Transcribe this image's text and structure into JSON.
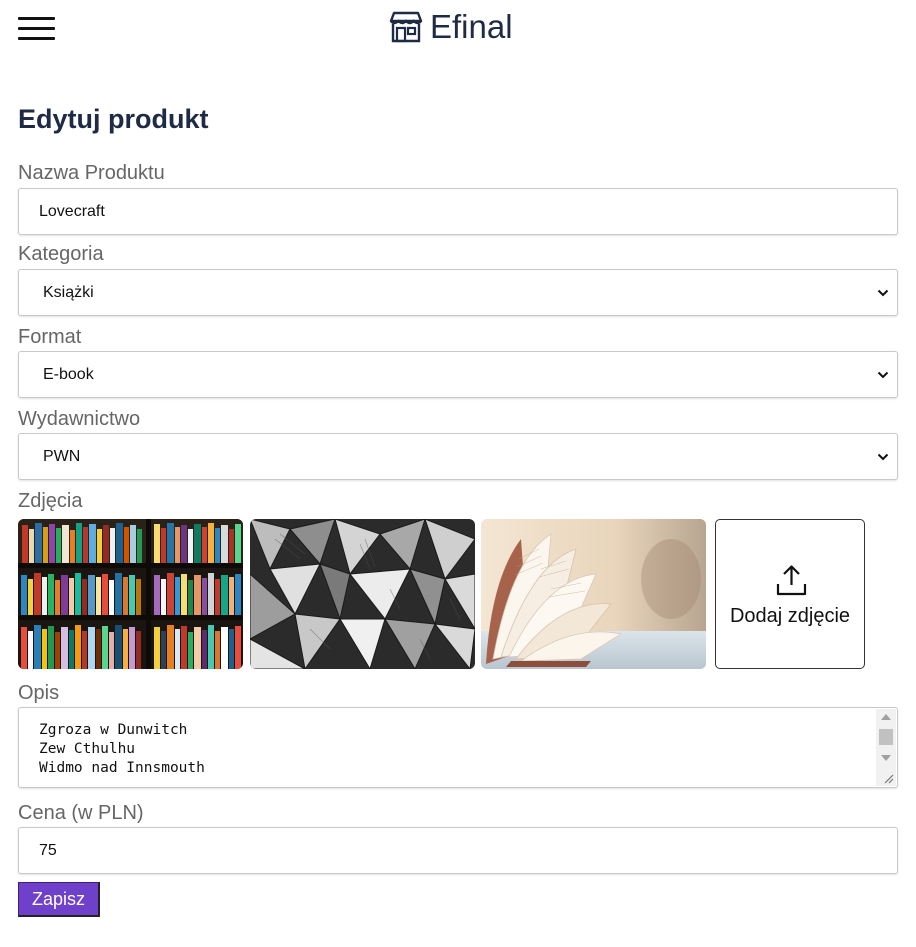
{
  "header": {
    "brand_name": "Efinal",
    "menu_icon": "hamburger-menu-icon",
    "logo_icon": "store-icon"
  },
  "page": {
    "title": "Edytuj produkt"
  },
  "form": {
    "name": {
      "label": "Nazwa Produktu",
      "value": "Lovecraft"
    },
    "category": {
      "label": "Kategoria",
      "value": "Książki"
    },
    "format": {
      "label": "Format",
      "value": "E-book"
    },
    "publisher": {
      "label": "Wydawnictwo",
      "value": "PWN"
    },
    "photos": {
      "label": "Zdjęcia",
      "items": [
        {
          "icon": "bookshelf-photo"
        },
        {
          "icon": "book-pages-bw-photo"
        },
        {
          "icon": "open-book-photo"
        }
      ],
      "add_label": "Dodaj zdjęcie",
      "add_icon": "upload-icon"
    },
    "description": {
      "label": "Opis",
      "lines": [
        "Zgroza w Dunwitch",
        "Zew Cthulhu",
        "Widmo nad Innsmouth"
      ]
    },
    "price": {
      "label": "Cena (w PLN)",
      "value": "75"
    },
    "save_label": "Zapisz"
  },
  "colors": {
    "accent": "#6f40c9",
    "heading": "#1f2a44",
    "label": "#666666"
  }
}
